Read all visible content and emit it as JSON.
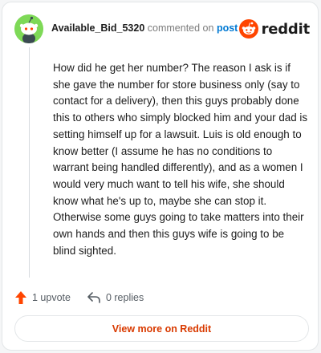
{
  "header": {
    "username": "Available_Bid_5320",
    "commented_on": "commented on",
    "post_link": "post",
    "logo_text": "reddit"
  },
  "comment": {
    "body": "How did he get her number? The reason I ask is if she gave the number for store business only (say to contact for a delivery), then this guys probably done this to others who simply blocked him and your dad is setting himself up for a lawsuit. Luis is old enough to know better (I assume he has no conditions to warrant being handled differently), and as a women I would very much want to tell his wife, she should know what he's up to, maybe she can stop it. Otherwise some guys going to take matters into their own hands and then this guys wife is going to be blind sighted."
  },
  "actions": {
    "upvote_label": "1 upvote",
    "replies_label": "0 replies"
  },
  "footer": {
    "view_more_label": "View more on Reddit"
  },
  "colors": {
    "brand": "#ff4500",
    "link": "#0079d3",
    "avatar_bg": "#7ed957",
    "view_more_text": "#d93a00"
  },
  "icons": [
    "snoo-avatar-icon",
    "reddit-logo-icon",
    "upvote-arrow-icon",
    "reply-icon"
  ]
}
